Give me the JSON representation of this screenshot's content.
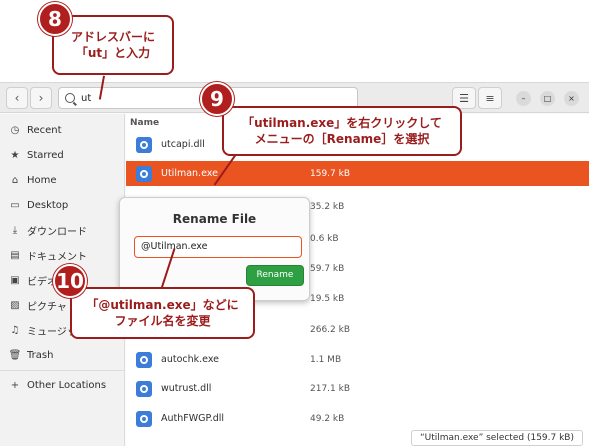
{
  "header": {
    "back_icon": "chevron-left",
    "forward_icon": "chevron-right",
    "address_value": "ut",
    "view_icon": "view-list",
    "menu_icon": "hamburger-menu"
  },
  "window_controls": {
    "minimize": "–",
    "maximize": "□",
    "close": "×"
  },
  "sidebar": {
    "items": [
      {
        "icon": "clock",
        "label": "Recent"
      },
      {
        "icon": "star",
        "label": "Starred"
      },
      {
        "icon": "home",
        "label": "Home"
      },
      {
        "icon": "desktop",
        "label": "Desktop"
      },
      {
        "icon": "download",
        "label": "ダウンロード"
      },
      {
        "icon": "document",
        "label": "ドキュメント"
      },
      {
        "icon": "video",
        "label": "ビデオ"
      },
      {
        "icon": "picture",
        "label": "ピクチャ"
      },
      {
        "icon": "music",
        "label": "ミュージック"
      },
      {
        "icon": "trash",
        "label": "Trash"
      },
      {
        "icon": "plus",
        "label": "Other Locations"
      }
    ]
  },
  "list": {
    "column_name": "Name",
    "files": [
      {
        "name": "utcapi.dll",
        "size": ""
      },
      {
        "name": "Utilman.exe",
        "size": "159.7 kB",
        "selected": true
      },
      {
        "name": "",
        "size": "35.2 kB"
      },
      {
        "name": "",
        "size": "0.6 kB"
      },
      {
        "name": "",
        "size": "59.7 kB"
      },
      {
        "name": "",
        "size": "19.5 kB"
      },
      {
        "name": "",
        "size": "266.2 kB"
      },
      {
        "name": "autochk.exe",
        "size": "1.1 MB"
      },
      {
        "name": "wutrust.dll",
        "size": "217.1 kB"
      },
      {
        "name": "AuthFWGP.dll",
        "size": "49.2 kB"
      }
    ]
  },
  "rename_popover": {
    "title": "Rename File",
    "input_value": "@Utilman.exe",
    "button_label": "Rename"
  },
  "status_text": "“Utilman.exe” selected  (159.7 kB)",
  "callouts": {
    "c8": {
      "number": "8",
      "line1": "アドレスバーに",
      "line2": "「ut」と入力"
    },
    "c9": {
      "number": "9",
      "line1": "「utilman.exe」を右クリックして",
      "line2": "メニューの［Rename］を選択"
    },
    "c10": {
      "number": "10",
      "line1": "「@utilman.exe」などに",
      "line2": "ファイル名を変更"
    }
  },
  "colors": {
    "accent": "#e95420",
    "callout": "#9b1c1c",
    "rename_button": "#2ea043"
  }
}
